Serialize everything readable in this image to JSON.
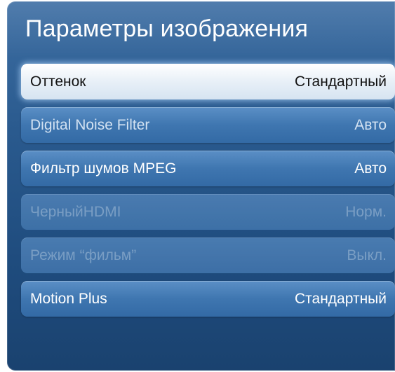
{
  "menu": {
    "title": "Параметры изображения",
    "items": [
      {
        "label": "Оттенок",
        "value": "Стандартный"
      },
      {
        "label": "Digital Noise Filter",
        "value": "Авто"
      },
      {
        "label": "Фильтр шумов MPEG",
        "value": "Авто"
      },
      {
        "label": "ЧерныйHDMI",
        "value": "Норм."
      },
      {
        "label": "Режим “фильм”",
        "value": "Выкл."
      },
      {
        "label": "Motion Plus",
        "value": "Стандартный"
      }
    ]
  }
}
